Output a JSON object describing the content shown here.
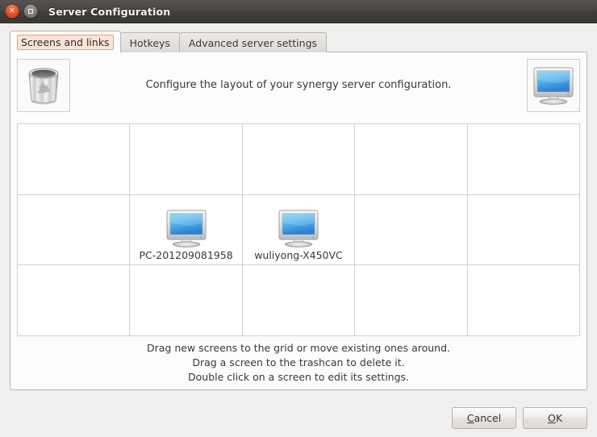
{
  "window": {
    "title": "Server Configuration",
    "close_icon": "close-icon",
    "maximize_icon": "maximize-icon"
  },
  "tabs": [
    {
      "id": "screens-and-links",
      "label": "Screens and links",
      "active": true
    },
    {
      "id": "hotkeys",
      "label": "Hotkeys",
      "active": false
    },
    {
      "id": "advanced-server-settings",
      "label": "Advanced server settings",
      "active": false
    }
  ],
  "header": {
    "caption": "Configure the layout of your synergy server configuration.",
    "trash_icon": "trashcan-icon",
    "new_screen_icon": "monitor-icon"
  },
  "grid": {
    "columns": 5,
    "rows": 3,
    "screens": [
      {
        "row": 1,
        "col": 1,
        "name": "PC-201209081958",
        "icon": "monitor-icon"
      },
      {
        "row": 1,
        "col": 2,
        "name": "wuliyong-X450VC",
        "icon": "monitor-icon"
      }
    ]
  },
  "hints": {
    "line1": "Drag new screens to the grid or move existing ones around.",
    "line2": "Drag a screen to the trashcan to delete it.",
    "line3": "Double click on a screen to edit its settings."
  },
  "buttons": {
    "cancel": {
      "mnemonic": "C",
      "rest": "ancel"
    },
    "ok": {
      "mnemonic": "O",
      "rest": "K"
    }
  },
  "colors": {
    "titlebar": "#45423f",
    "close_button": "#e0522a",
    "tab_focus_ring": "#f0a070",
    "tab_focus_fill": "#fbe4d5",
    "panel_background": "#fcfcfc",
    "dialog_background": "#f0efee",
    "grid_line": "#d3d0cd",
    "screen_blue": "#4aa3e8"
  }
}
